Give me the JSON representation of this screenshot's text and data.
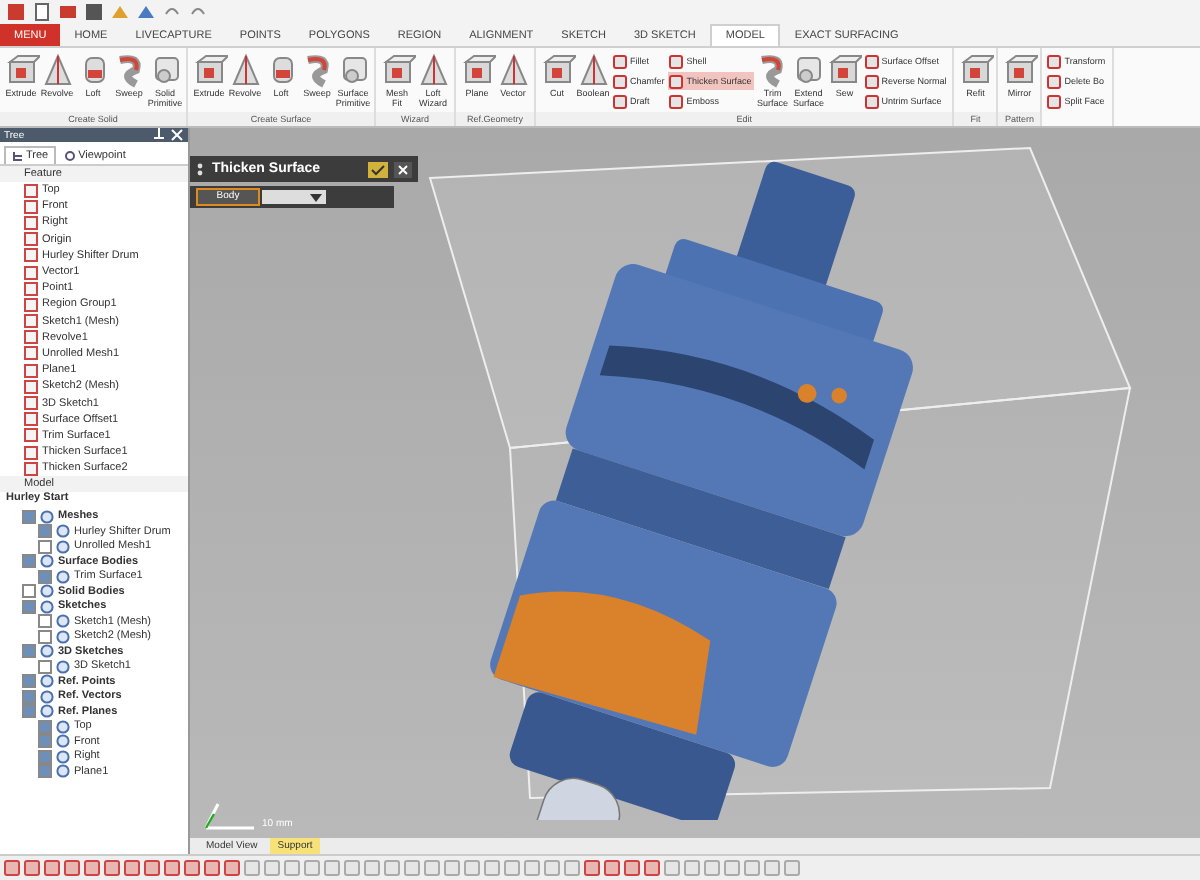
{
  "tabs": [
    {
      "label": "MENU",
      "kind": "menu",
      "selected": false
    },
    {
      "label": "HOME",
      "selected": false
    },
    {
      "label": "LIVECAPTURE",
      "selected": false
    },
    {
      "label": "POINTS",
      "selected": false
    },
    {
      "label": "POLYGONS",
      "selected": false
    },
    {
      "label": "REGION",
      "selected": false
    },
    {
      "label": "ALIGNMENT",
      "selected": false
    },
    {
      "label": "SKETCH",
      "selected": false
    },
    {
      "label": "3D SKETCH",
      "selected": false
    },
    {
      "label": "MODEL",
      "selected": true
    },
    {
      "label": "EXACT SURFACING",
      "selected": false
    }
  ],
  "ribbon": [
    {
      "label": "Create Solid",
      "tools": [
        {
          "label": "Extrude",
          "kind": "large",
          "selected": false
        },
        {
          "label": "Revolve",
          "kind": "large",
          "selected": false
        },
        {
          "label": "Loft",
          "kind": "large",
          "selected": false
        },
        {
          "label": "Sweep",
          "kind": "large",
          "selected": false
        },
        {
          "label": "Solid Primitive",
          "kind": "large",
          "selected": false
        }
      ]
    },
    {
      "label": "Create Surface",
      "tools": [
        {
          "label": "Extrude",
          "kind": "large",
          "selected": false
        },
        {
          "label": "Revolve",
          "kind": "large",
          "selected": false
        },
        {
          "label": "Loft",
          "kind": "large",
          "selected": false
        },
        {
          "label": "Sweep",
          "kind": "large",
          "selected": false
        },
        {
          "label": "Surface Primitive",
          "kind": "large",
          "selected": false
        }
      ]
    },
    {
      "label": "Wizard",
      "tools": [
        {
          "label": "Mesh Fit",
          "kind": "large",
          "selected": false
        },
        {
          "label": "Loft Wizard",
          "kind": "large",
          "selected": false
        }
      ]
    },
    {
      "label": "Ref.Geometry",
      "tools": [
        {
          "label": "Plane",
          "kind": "large",
          "selected": false
        },
        {
          "label": "Vector",
          "kind": "large",
          "selected": false
        }
      ]
    },
    {
      "label": "Edit",
      "tools": [
        {
          "label": "Cut",
          "kind": "large",
          "selected": false
        },
        {
          "label": "Boolean",
          "kind": "large",
          "selected": false
        },
        {
          "label": "Fillet",
          "kind": "small",
          "selected": false
        },
        {
          "label": "Chamfer",
          "kind": "small",
          "selected": false
        },
        {
          "label": "Draft",
          "kind": "small",
          "selected": false
        },
        {
          "label": "Shell",
          "kind": "small",
          "selected": false
        },
        {
          "label": "Thicken Surface",
          "kind": "small",
          "selected": true
        },
        {
          "label": "Emboss",
          "kind": "small",
          "selected": false
        },
        {
          "label": "Trim Surface",
          "kind": "large",
          "selected": false
        },
        {
          "label": "Extend Surface",
          "kind": "large",
          "selected": false
        },
        {
          "label": "Sew",
          "kind": "large",
          "selected": false
        },
        {
          "label": "Surface Offset",
          "kind": "small",
          "selected": false
        },
        {
          "label": "Reverse Normal",
          "kind": "small",
          "selected": false
        },
        {
          "label": "Untrim Surface",
          "kind": "small",
          "selected": false
        }
      ]
    },
    {
      "label": "Fit",
      "tools": [
        {
          "label": "Refit",
          "kind": "large",
          "selected": false
        }
      ]
    },
    {
      "label": "Pattern",
      "tools": [
        {
          "label": "Mirror",
          "kind": "large",
          "selected": false
        }
      ]
    },
    {
      "tools": [
        {
          "label": "Transform",
          "kind": "small",
          "selected": false
        },
        {
          "label": "Delete Bo",
          "kind": "small",
          "selected": false
        },
        {
          "label": "Split Face",
          "kind": "small",
          "selected": false
        }
      ]
    }
  ],
  "panel": {
    "title": "Tree",
    "tabs": [
      {
        "label": "Tree",
        "selected": true
      },
      {
        "label": "Viewpoint",
        "selected": false
      }
    ],
    "feature_heading": "Feature",
    "features": [
      "Top",
      "Front",
      "Right",
      "Origin",
      "Hurley Shifter Drum",
      "Vector1",
      "Point1",
      "Region Group1",
      "Sketch1 (Mesh)",
      "Revolve1",
      "Unrolled Mesh1",
      "Plane1",
      "Sketch2 (Mesh)",
      "3D Sketch1",
      "Surface Offset1",
      "Trim Surface1",
      "Thicken Surface1",
      "Thicken Surface2"
    ],
    "model_heading": "Model",
    "model_root": "Hurley Start",
    "model": [
      {
        "label": "Meshes",
        "checked": true,
        "children": [
          {
            "label": "Hurley Shifter Drum",
            "checked": true
          },
          {
            "label": "Unrolled Mesh1",
            "checked": false
          }
        ]
      },
      {
        "label": "Surface Bodies",
        "checked": true,
        "children": [
          {
            "label": "Trim Surface1",
            "checked": true
          }
        ]
      },
      {
        "label": "Solid Bodies",
        "checked": false
      },
      {
        "label": "Sketches",
        "checked": true,
        "children": [
          {
            "label": "Sketch1 (Mesh)",
            "checked": false
          },
          {
            "label": "Sketch2 (Mesh)",
            "checked": false
          }
        ]
      },
      {
        "label": "3D Sketches",
        "checked": true,
        "children": [
          {
            "label": "3D Sketch1",
            "checked": false
          }
        ]
      },
      {
        "label": "Ref. Points",
        "checked": true
      },
      {
        "label": "Ref. Vectors",
        "checked": true
      },
      {
        "label": "Ref. Planes",
        "checked": true,
        "children": [
          {
            "label": "Top",
            "checked": true
          },
          {
            "label": "Front",
            "checked": true
          },
          {
            "label": "Right",
            "checked": true
          },
          {
            "label": "Plane1",
            "checked": true
          }
        ]
      }
    ]
  },
  "dialog": {
    "title": "Thicken Surface",
    "field": {
      "value": "Body"
    }
  },
  "scale_label": "10 mm",
  "view_tabs": [
    {
      "label": "Model View",
      "selected": false
    },
    {
      "label": "Support",
      "selected": true
    }
  ]
}
